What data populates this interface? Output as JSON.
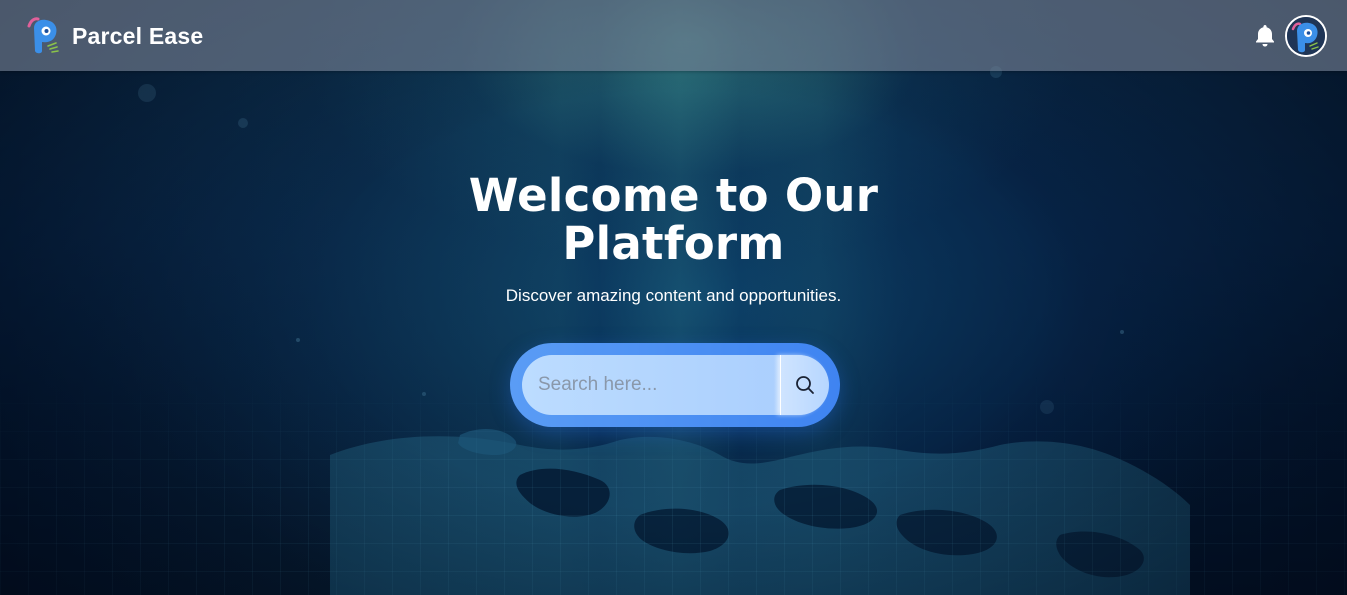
{
  "navbar": {
    "brand_name": "Parcel Ease",
    "icons": [
      "parcel-ease-logo-icon",
      "bell-icon",
      "avatar"
    ]
  },
  "hero": {
    "title": "Welcome to Our Platform",
    "subtitle": "Discover amazing content and opportunities."
  },
  "search": {
    "placeholder": "Search here...",
    "button_icon": "search-icon"
  },
  "colors": {
    "navbar_bg": "#7a8296",
    "search_outer": "#4a8ff3",
    "search_inner": "#b4d5fe",
    "text": "#ffffff",
    "logo_blue": "#3b8fe8",
    "logo_pink": "#e0609a",
    "logo_green": "#8bc34a"
  }
}
